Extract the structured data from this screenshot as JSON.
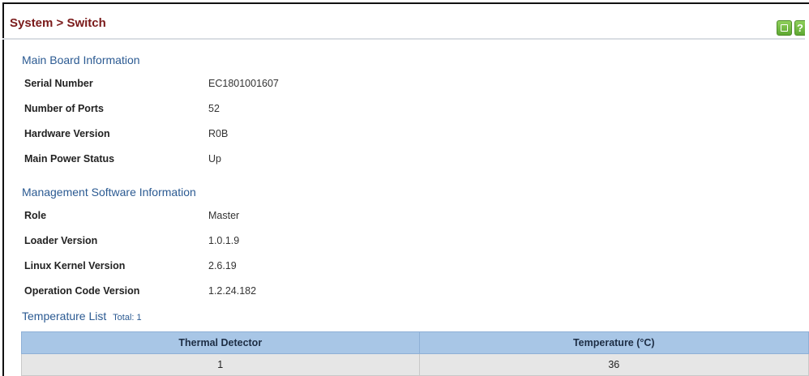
{
  "header": {
    "title": "System > Switch"
  },
  "main_board": {
    "title": "Main Board Information",
    "rows": [
      {
        "label": "Serial Number",
        "value": "EC1801001607"
      },
      {
        "label": "Number of Ports",
        "value": "52"
      },
      {
        "label": "Hardware Version",
        "value": "R0B"
      },
      {
        "label": "Main Power Status",
        "value": "Up"
      }
    ]
  },
  "software": {
    "title": "Management Software Information",
    "rows": [
      {
        "label": "Role",
        "value": "Master"
      },
      {
        "label": "Loader Version",
        "value": "1.0.1.9"
      },
      {
        "label": "Linux Kernel Version",
        "value": "2.6.19"
      },
      {
        "label": "Operation Code Version",
        "value": "1.2.24.182"
      }
    ]
  },
  "temperature": {
    "title": "Temperature List",
    "total": "Total: 1",
    "columns": [
      "Thermal Detector",
      "Temperature (°C)"
    ],
    "rows": [
      {
        "detector": "1",
        "temp": "36"
      }
    ]
  },
  "icons": {
    "save": "save-icon",
    "help": "help-icon",
    "accent": "#6bb83a"
  }
}
